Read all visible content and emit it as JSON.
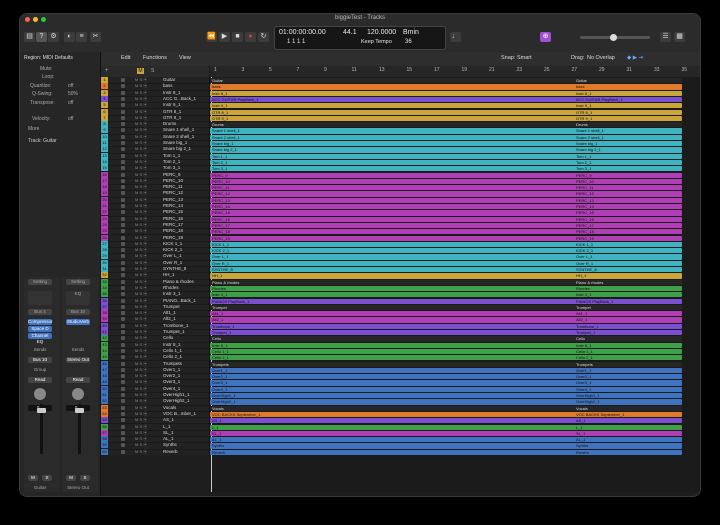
{
  "window": {
    "title": "biggieTest - Tracks"
  },
  "lcd": {
    "time": "01:00:00:00.00",
    "bars": "1  1  1     1",
    "sample_rate": "44.1",
    "tempo": "120.0000",
    "tempo_label": "Keep Tempo",
    "key": "Bmin",
    "meter": "36"
  },
  "toolbar": {
    "edit": "Edit",
    "functions": "Functions",
    "view": "View",
    "snap_label": "Snap:",
    "snap": "Smart",
    "drag_label": "Drag:",
    "drag": "No Overlap"
  },
  "inspector": {
    "region": "Region: MIDI Defaults",
    "mute": "Mute:",
    "loop": "Loop:",
    "quantize_label": "Quantize:",
    "quantize": "off",
    "qswing_label": "Q-Swing:",
    "qswing": "50%",
    "transpose_label": "Transpose:",
    "transpose": "off",
    "velocity_label": "Velocity:",
    "velocity": "off",
    "more": "More",
    "track": "Track: Guitar",
    "setting": "Setting",
    "eq": "EQ",
    "bus": "Bus 4",
    "bus2": "Bus 10",
    "plug1": "Compressor",
    "plug2": "Space D",
    "plug3": "Channel EQ",
    "plug4": "StudioVerb",
    "sends_l": "Sends",
    "sends_r": "Sends",
    "send_a": "Bus 10",
    "send_b": "Stereo Out",
    "group": "Group",
    "read": "Read",
    "val_l": "0.0",
    "val_r": "0.0",
    "m": "M",
    "s": "S",
    "name_l": "Guitar",
    "name_r": "Stereo Out"
  },
  "ruler": {
    "ticks": [
      "1",
      "3",
      "5",
      "7",
      "9",
      "11",
      "13",
      "15",
      "17",
      "19",
      "21",
      "23",
      "25",
      "27",
      "29",
      "31",
      "33",
      "35"
    ]
  },
  "colors": {
    "yellow": "#c9a53c",
    "orange": "#e07a2d",
    "purple": "#7a4fd0",
    "cyan": "#3fb3c0",
    "green": "#3fa04a",
    "magenta": "#b03fb5",
    "blue": "#3f73c0",
    "lime": "#8fb03f",
    "teal": "#2f9c8a"
  },
  "tracks": [
    {
      "n": "1",
      "name": "Guitar",
      "color": "#c9a53c"
    },
    {
      "n": "2",
      "name": "bass",
      "color": "#e07a2d"
    },
    {
      "n": "3",
      "name": "Instr 8_1",
      "color": "#c9a53c"
    },
    {
      "n": "4",
      "name": "ACC G...Back_1",
      "color": "#7a4fd0"
    },
    {
      "n": "5",
      "name": "Instr 9_1",
      "color": "#c9a53c"
    },
    {
      "n": "6",
      "name": "GTR 8_1",
      "color": "#c9a53c"
    },
    {
      "n": "7",
      "name": "GTR 9_1",
      "color": "#c9a53c"
    },
    {
      "n": "8",
      "name": "Drums",
      "color": "#3fb3c0"
    },
    {
      "n": "9",
      "name": "Snare 1 shell_1",
      "color": "#3fb3c0"
    },
    {
      "n": "10",
      "name": "Snare 2 shell_1",
      "color": "#3fb3c0"
    },
    {
      "n": "11",
      "name": "Snare big_1",
      "color": "#3fb3c0"
    },
    {
      "n": "12",
      "name": "Snare big 2_1",
      "color": "#3fb3c0"
    },
    {
      "n": "13",
      "name": "Tom 1_1",
      "color": "#3fb3c0"
    },
    {
      "n": "14",
      "name": "Tom 2_1",
      "color": "#3fb3c0"
    },
    {
      "n": "15",
      "name": "Tom 3_1",
      "color": "#3fb3c0"
    },
    {
      "n": "16",
      "name": "PERC_9",
      "color": "#b03fb5"
    },
    {
      "n": "17",
      "name": "PERC_10",
      "color": "#b03fb5"
    },
    {
      "n": "18",
      "name": "PERC_11",
      "color": "#b03fb5"
    },
    {
      "n": "19",
      "name": "PERC_12",
      "color": "#b03fb5"
    },
    {
      "n": "20",
      "name": "PERC_13",
      "color": "#b03fb5"
    },
    {
      "n": "21",
      "name": "PERC_14",
      "color": "#b03fb5"
    },
    {
      "n": "22",
      "name": "PERC_15",
      "color": "#b03fb5"
    },
    {
      "n": "23",
      "name": "PERC_16",
      "color": "#b03fb5"
    },
    {
      "n": "24",
      "name": "PERC_17",
      "color": "#b03fb5"
    },
    {
      "n": "25",
      "name": "PERC_18",
      "color": "#b03fb5"
    },
    {
      "n": "26",
      "name": "PERC_19",
      "color": "#b03fb5"
    },
    {
      "n": "27",
      "name": "KICK 1_1",
      "color": "#3fb3c0"
    },
    {
      "n": "28",
      "name": "KICK 2_1",
      "color": "#3fb3c0"
    },
    {
      "n": "29",
      "name": "Over L_1",
      "color": "#3fb3c0"
    },
    {
      "n": "30",
      "name": "Over R_1",
      "color": "#3fb3c0"
    },
    {
      "n": "31",
      "name": "SYNTHE_8",
      "color": "#3fb3c0"
    },
    {
      "n": "32",
      "name": "HH_1",
      "color": "#c9a53c"
    },
    {
      "n": "33",
      "name": "Piano & rhodes",
      "color": "#3fa04a"
    },
    {
      "n": "34",
      "name": "Rhodes",
      "color": "#3fa04a"
    },
    {
      "n": "35",
      "name": "Instr 3_1",
      "color": "#3fa04a"
    },
    {
      "n": "36",
      "name": "PIANO...Back_1",
      "color": "#7a4fd0"
    },
    {
      "n": "37",
      "name": "Trumpet",
      "color": "#7a4fd0"
    },
    {
      "n": "38",
      "name": "Alt1_1",
      "color": "#b03fb5"
    },
    {
      "n": "39",
      "name": "Alt2_1",
      "color": "#b03fb5"
    },
    {
      "n": "40",
      "name": "Trombone_1",
      "color": "#7a4fd0"
    },
    {
      "n": "41",
      "name": "Trumpet_1",
      "color": "#7a4fd0"
    },
    {
      "n": "42",
      "name": "Cello",
      "color": "#3fa04a"
    },
    {
      "n": "43",
      "name": "Instr 8_1",
      "color": "#3fa04a"
    },
    {
      "n": "44",
      "name": "Cello 1_1",
      "color": "#3fa04a"
    },
    {
      "n": "45",
      "name": "Cello 2_1",
      "color": "#3fa04a"
    },
    {
      "n": "46",
      "name": "Trumpets",
      "color": "#3f73c0"
    },
    {
      "n": "47",
      "name": "Over1_1",
      "color": "#3f73c0"
    },
    {
      "n": "48",
      "name": "Over2_1",
      "color": "#3f73c0"
    },
    {
      "n": "49",
      "name": "Over3_1",
      "color": "#3f73c0"
    },
    {
      "n": "50",
      "name": "Over4_1",
      "color": "#3f73c0"
    },
    {
      "n": "51",
      "name": "OverHigh1_1",
      "color": "#3f73c0"
    },
    {
      "n": "52",
      "name": "OverHigh2_1",
      "color": "#3f73c0"
    },
    {
      "n": "53",
      "name": "Vocals",
      "color": "#e07a2d"
    },
    {
      "n": "54",
      "name": "VOC B...mber_1",
      "color": "#e07a2d"
    },
    {
      "n": "55",
      "name": "AS_1",
      "color": "#7a4fd0"
    },
    {
      "n": "56",
      "name": "L_1",
      "color": "#3fa04a"
    },
    {
      "n": "57",
      "name": "SL_1",
      "color": "#b03fb5"
    },
    {
      "n": "58",
      "name": "AL_1",
      "color": "#3f73c0"
    },
    {
      "n": "59",
      "name": "Synths",
      "color": "#3f73c0"
    },
    {
      "n": "60",
      "name": "Reverb",
      "color": "#3f73c0"
    }
  ],
  "regions": [
    {
      "a": "Guitar",
      "b": "Guitar",
      "color": "#2a2a2a",
      "hdr": true
    },
    {
      "a": "bass",
      "b": "bass",
      "color": "#e07a2d"
    },
    {
      "a": "Instr 8_1",
      "b": "Instr 8_1",
      "color": "#c9a53c"
    },
    {
      "a": "ACC GUITAR PlayBack_1",
      "b": "ACC GUITAR PlayBack_1",
      "color": "#7a4fd0"
    },
    {
      "a": "Instr 9_1",
      "b": "Instr 9_1",
      "color": "#c9a53c"
    },
    {
      "a": "GTR 8_1",
      "b": "GTR 8_1",
      "color": "#c9a53c"
    },
    {
      "a": "GTR 9_1",
      "b": "GTR 9_1",
      "color": "#c9a53c"
    },
    {
      "a": "Drums",
      "b": "Drums",
      "color": "#2a2a2a",
      "hdr": true
    },
    {
      "a": "Snare 1 shell_1",
      "b": "Snare 1 shell_1",
      "color": "#3fb3c0"
    },
    {
      "a": "Snare 2 shell_1",
      "b": "Snare 2 shell_1",
      "color": "#3fb3c0"
    },
    {
      "a": "Snare big_1",
      "b": "Snare big_1",
      "color": "#3fb3c0"
    },
    {
      "a": "Snare big 2_1",
      "b": "Snare big 2_1",
      "color": "#3fb3c0"
    },
    {
      "a": "Tom 1_1",
      "b": "Tom 1_1",
      "color": "#3fb3c0"
    },
    {
      "a": "Tom 2_1",
      "b": "Tom 2_1",
      "color": "#3fb3c0"
    },
    {
      "a": "Tom 3_1",
      "b": "Tom 3_1",
      "color": "#3fb3c0"
    },
    {
      "a": "PERC_9",
      "b": "PERC_9",
      "color": "#b03fb5"
    },
    {
      "a": "PERC_10",
      "b": "PERC_10",
      "color": "#b03fb5"
    },
    {
      "a": "PERC_11",
      "b": "PERC_11",
      "color": "#b03fb5"
    },
    {
      "a": "PERC_12",
      "b": "PERC_12",
      "color": "#b03fb5"
    },
    {
      "a": "PERC_13",
      "b": "PERC_13",
      "color": "#b03fb5"
    },
    {
      "a": "PERC_14",
      "b": "PERC_14",
      "color": "#b03fb5"
    },
    {
      "a": "PERC_15",
      "b": "PERC_15",
      "color": "#b03fb5"
    },
    {
      "a": "PERC_16",
      "b": "PERC_16",
      "color": "#b03fb5"
    },
    {
      "a": "PERC_17",
      "b": "PERC_17",
      "color": "#b03fb5"
    },
    {
      "a": "PERC_18",
      "b": "PERC_18",
      "color": "#b03fb5"
    },
    {
      "a": "PERC_19",
      "b": "PERC_19",
      "color": "#b03fb5"
    },
    {
      "a": "KICK 1_1",
      "b": "KICK 1_1",
      "color": "#3fb3c0"
    },
    {
      "a": "KICK 2_1",
      "b": "KICK 2_1",
      "color": "#3fb3c0"
    },
    {
      "a": "Over L_1",
      "b": "Over L_1",
      "color": "#3fb3c0"
    },
    {
      "a": "Over R_1",
      "b": "Over R_1",
      "color": "#3fb3c0"
    },
    {
      "a": "SYNTHE_8",
      "b": "SYNTHE_8",
      "color": "#3fb3c0"
    },
    {
      "a": "HH_1",
      "b": "HH_1",
      "color": "#c9a53c"
    },
    {
      "a": "Piano & rhodes",
      "b": "Piano & rhodes",
      "color": "#2a2a2a",
      "hdr": true
    },
    {
      "a": "Rhodes",
      "b": "Rhodes",
      "color": "#3fa04a"
    },
    {
      "a": "Instr 3_1",
      "b": "Instr 3_1",
      "color": "#3fa04a"
    },
    {
      "a": "PIANOS PlayBack_1",
      "b": "PIANOS PlayBack_1",
      "color": "#7a4fd0"
    },
    {
      "a": "Trumpet",
      "b": "Trumpet",
      "color": "#2a2a2a",
      "hdr": true
    },
    {
      "a": "Alt1_1",
      "b": "Alt1_1",
      "color": "#b03fb5"
    },
    {
      "a": "Alt2_1",
      "b": "Alt2_1",
      "color": "#b03fb5"
    },
    {
      "a": "Trombone_1",
      "b": "Trombone_1",
      "color": "#7a4fd0"
    },
    {
      "a": "Trumpet_1",
      "b": "Trumpet_1",
      "color": "#7a4fd0"
    },
    {
      "a": "Cello",
      "b": "Cello",
      "color": "#2a2a2a",
      "hdr": true
    },
    {
      "a": "Instr 8_1",
      "b": "Instr 8_1",
      "color": "#3fa04a"
    },
    {
      "a": "Cello 1_1",
      "b": "Cello 1_1",
      "color": "#3fa04a"
    },
    {
      "a": "Cello 2_1",
      "b": "Cello 2_1",
      "color": "#3fa04a"
    },
    {
      "a": "Trumpets",
      "b": "Trumpets",
      "color": "#2a2a2a",
      "hdr": true
    },
    {
      "a": "Over1_1",
      "b": "Over1_1",
      "color": "#3f73c0"
    },
    {
      "a": "Over2_1",
      "b": "Over2_1",
      "color": "#3f73c0"
    },
    {
      "a": "Over3_1",
      "b": "Over3_1",
      "color": "#3f73c0"
    },
    {
      "a": "Over4_1",
      "b": "Over4_1",
      "color": "#3f73c0"
    },
    {
      "a": "OverHigh1_1",
      "b": "OverHigh1_1",
      "color": "#3f73c0"
    },
    {
      "a": "OverHigh2_1",
      "b": "OverHigh2_1",
      "color": "#3f73c0"
    },
    {
      "a": "Vocals",
      "b": "Vocals",
      "color": "#2a2a2a",
      "hdr": true
    },
    {
      "a": "VOC BACKS September_1",
      "b": "VOC BACKS September_1",
      "color": "#e07a2d"
    },
    {
      "a": "AS_1",
      "b": "AS_1",
      "color": "#7a4fd0"
    },
    {
      "a": "L_1",
      "b": "L_1",
      "color": "#3fa04a"
    },
    {
      "a": "SL_1",
      "b": "SL_1",
      "color": "#b03fb5"
    },
    {
      "a": "AL_1",
      "b": "AL_1",
      "color": "#3f73c0"
    },
    {
      "a": "Synths",
      "b": "Synths",
      "color": "#3f73c0"
    },
    {
      "a": "Reverb",
      "b": "Reverb",
      "color": "#3f73c0"
    }
  ]
}
